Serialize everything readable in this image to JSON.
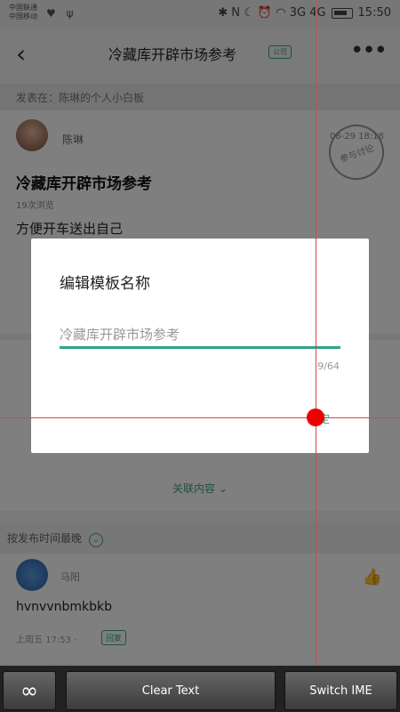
{
  "status_bar": {
    "carrier1": "中国联通",
    "carrier2": "中国移动",
    "left_icons": "♥ ψ",
    "right_icons": "✱ N ☾ ⏰ ◠ 3G 4G",
    "time": "15:50"
  },
  "nav": {
    "back_glyph": "‹",
    "title": "冷藏库开辟市场参考",
    "badge": "公司",
    "more_glyph": "•••"
  },
  "published_in": "发表在：陈琳的个人小白板",
  "post": {
    "author": "陈琳",
    "date": "08-29 18:18",
    "stamp": "参与讨论",
    "title": "冷藏库开辟市场参考",
    "views": "19次浏览",
    "body": "方便开车送出自己"
  },
  "related": {
    "label": "关联内容",
    "chevron": "⌄"
  },
  "sort": {
    "label": "按发布时间最晚",
    "chevron": "⌄"
  },
  "comment": {
    "name": "马阳",
    "text": "hvnvvnbmkbkb",
    "time": "上周五 17:53 ·",
    "reply": "回复",
    "like_glyph": "👍"
  },
  "dialog": {
    "title": "编辑模板名称",
    "input_value": "冷藏库开辟市场参考",
    "counter": "9/64",
    "confirm": "确定"
  },
  "bottom_bar": {
    "infinity": "∞",
    "clear_text": "Clear Text",
    "switch_ime": "Switch IME"
  },
  "colors": {
    "accent": "#2aa58e",
    "crosshair": "#ee0000"
  }
}
